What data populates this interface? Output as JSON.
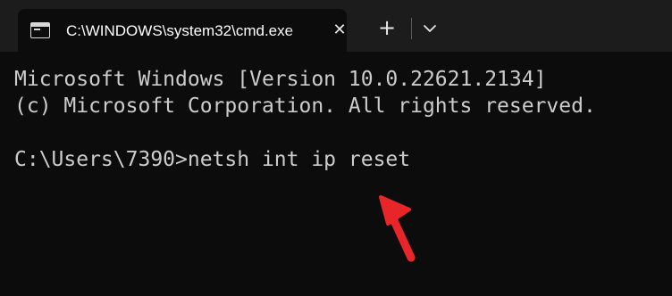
{
  "window": {
    "tab_title": "C:\\WINDOWS\\system32\\cmd.exe",
    "close_glyph": "✕",
    "new_tab_glyph": "+",
    "tab_icon": "terminal-icon",
    "dropdown_icon": "chevron-down-icon"
  },
  "terminal": {
    "lines": [
      "Microsoft Windows [Version 10.0.22621.2134]",
      "(c) Microsoft Corporation. All rights reserved.",
      "",
      "C:\\Users\\7390>netsh int ip reset"
    ]
  },
  "annotation": {
    "icon": "red-arrow-icon",
    "color": "#e8262a"
  },
  "colors": {
    "titlebar": "#1c1c1c",
    "terminal_background": "#0c0c0c",
    "terminal_text": "#cccccc"
  }
}
